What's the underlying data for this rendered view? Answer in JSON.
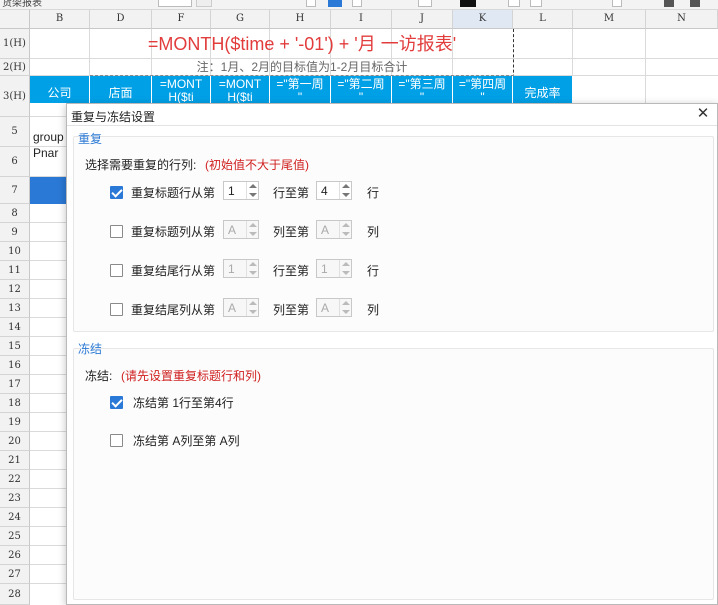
{
  "toolbar": {
    "name_box": "货架报表"
  },
  "columns": [
    "B",
    "D",
    "F",
    "G",
    "H",
    "I",
    "J",
    "K",
    "L",
    "M",
    "N"
  ],
  "rows": [
    {
      "label": "1(H)"
    },
    {
      "label": "2(H)"
    },
    {
      "label": "3(H)"
    },
    {
      "label": "5"
    },
    {
      "label": "6"
    },
    {
      "label": "7"
    },
    {
      "label": "8"
    },
    {
      "label": "9"
    },
    {
      "label": "10"
    },
    {
      "label": "11"
    },
    {
      "label": "12"
    },
    {
      "label": "13"
    },
    {
      "label": "14"
    },
    {
      "label": "15"
    },
    {
      "label": "16"
    },
    {
      "label": "17"
    },
    {
      "label": "18"
    },
    {
      "label": "19"
    },
    {
      "label": "20"
    },
    {
      "label": "21"
    },
    {
      "label": "22"
    },
    {
      "label": "23"
    },
    {
      "label": "24"
    },
    {
      "label": "25"
    },
    {
      "label": "26"
    },
    {
      "label": "27"
    },
    {
      "label": "28"
    }
  ],
  "sheet": {
    "title_formula": "=MONTH($time + '-01') + '月 一访报表'",
    "note": "注：1月、2月的目标值为1-2月目标合计",
    "header_cells": [
      "公司",
      "店面",
      "=MONT\nH($ti",
      "=MONT\nH($ti",
      "=\"第一周\n\"",
      "=\"第二周\n\"",
      "=\"第三周\n\"",
      "=\"第四周\n\"",
      "完成率"
    ],
    "row5_text": "group\nPnar"
  },
  "dialog": {
    "title": "重复与冻结设置",
    "repeat": {
      "section_title": "重复",
      "prompt": "选择需要重复的行列:",
      "prompt_note": "(初始值不大于尾值)",
      "options": [
        {
          "label": "重复标题行从第",
          "checked": true,
          "from": "1",
          "mid": "行至第",
          "to": "4",
          "unit": "行",
          "enabled": true
        },
        {
          "label": "重复标题列从第",
          "checked": false,
          "from": "A",
          "mid": "列至第",
          "to": "A",
          "unit": "列",
          "enabled": false
        },
        {
          "label": "重复结尾行从第",
          "checked": false,
          "from": "1",
          "mid": "行至第",
          "to": "1",
          "unit": "行",
          "enabled": false
        },
        {
          "label": "重复结尾列从第",
          "checked": false,
          "from": "A",
          "mid": "列至第",
          "to": "A",
          "unit": "列",
          "enabled": false
        }
      ]
    },
    "freeze": {
      "section_title": "冻结",
      "prompt": "冻结:",
      "prompt_note": "(请先设置重复标题行和列)",
      "options": [
        {
          "label": "冻结第 1行至第4行",
          "checked": true
        },
        {
          "label": "冻结第 A列至第 A列",
          "checked": false
        }
      ]
    }
  },
  "colors": {
    "accent": "#2b79d6",
    "header_cyan": "#00a0e6",
    "title_red": "#e23c3c",
    "note_red": "#d01f1f"
  }
}
